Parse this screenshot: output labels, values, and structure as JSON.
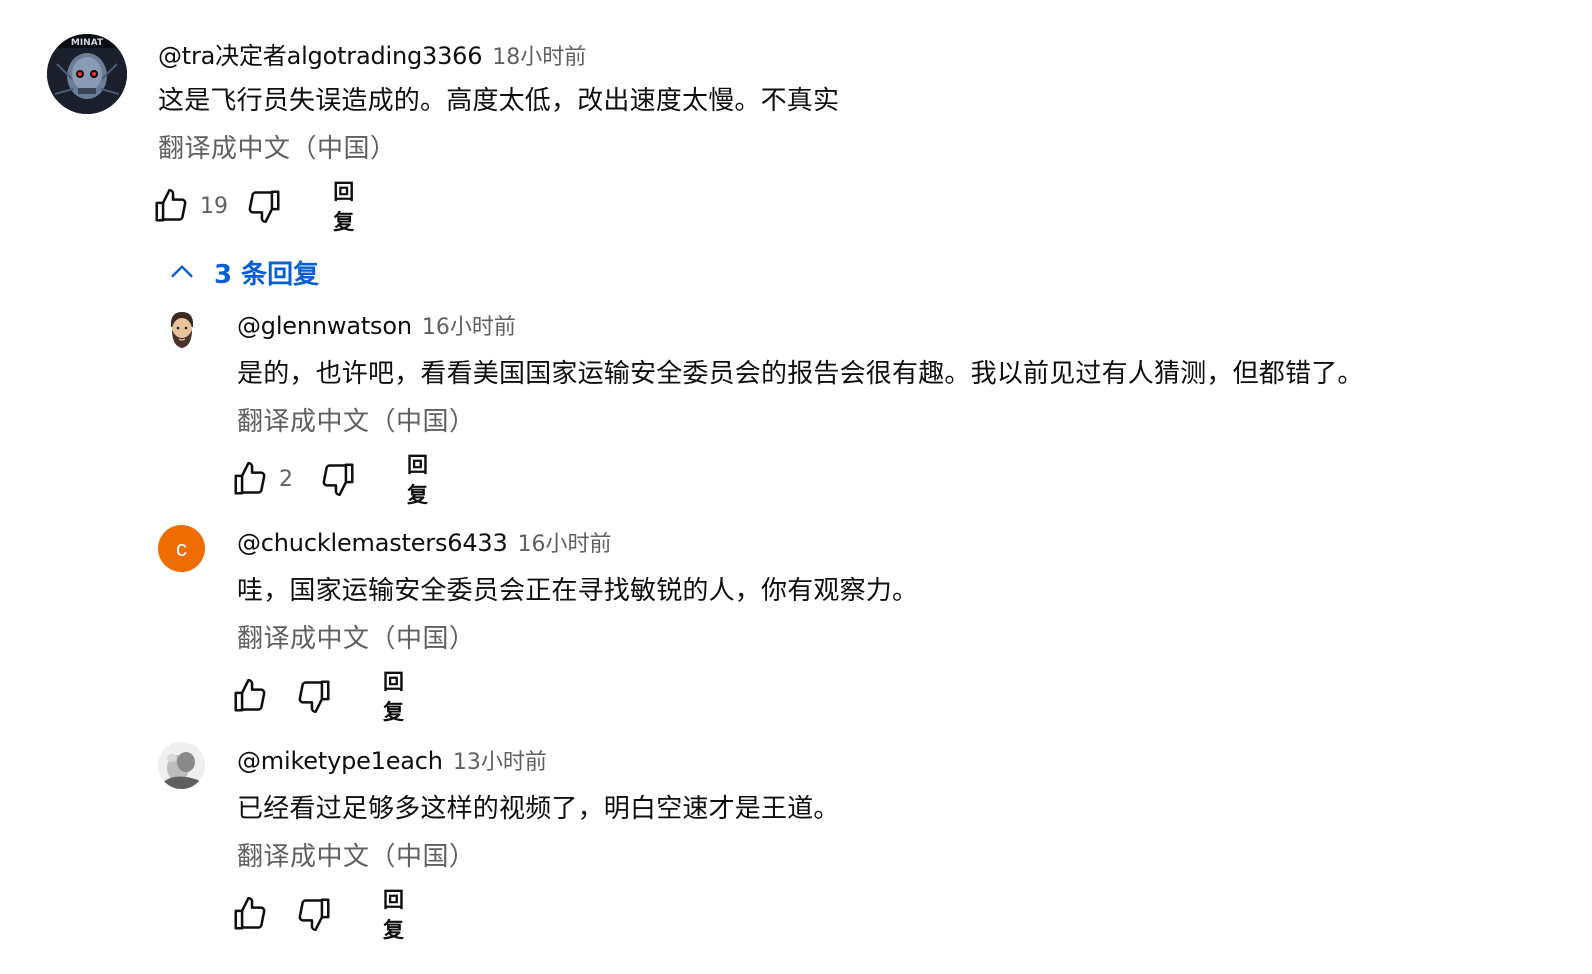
{
  "top_comment": {
    "author": "@tra决定者algotrading3366",
    "time": "18小时前",
    "text": "这是飞行员失误造成的。高度太低，改出速度太慢。不真实",
    "translate": "翻译成中文（中国）",
    "likes": "19",
    "reply_label": "回复",
    "avatar_icon": "terminator-skull-avatar"
  },
  "replies_toggle": {
    "label": "3 条回复",
    "icon": "chevron-up-icon",
    "color": "#065fd4"
  },
  "replies": [
    {
      "author": "@glennwatson",
      "time": "16小时前",
      "text": "是的，也许吧，看看美国国家运输安全委员会的报告会很有趣。我以前见过有人猜测，但都错了。",
      "translate": "翻译成中文（中国）",
      "likes": "2",
      "reply_label": "回复",
      "avatar_icon": "bearded-man-avatar"
    },
    {
      "author": "@chucklemasters6433",
      "time": "16小时前",
      "text": "哇，国家运输安全委员会正在寻找敏锐的人，你有观察力。",
      "translate": "翻译成中文（中国）",
      "likes": "",
      "reply_label": "回复",
      "avatar_letter": "c",
      "avatar_color": "#ef6c00"
    },
    {
      "author": "@miketype1each",
      "time": "13小时前",
      "text": "已经看过足够多这样的视频了，明白空速才是王道。",
      "translate": "翻译成中文（中国）",
      "likes": "",
      "reply_label": "回复",
      "avatar_icon": "photo-avatar"
    }
  ]
}
